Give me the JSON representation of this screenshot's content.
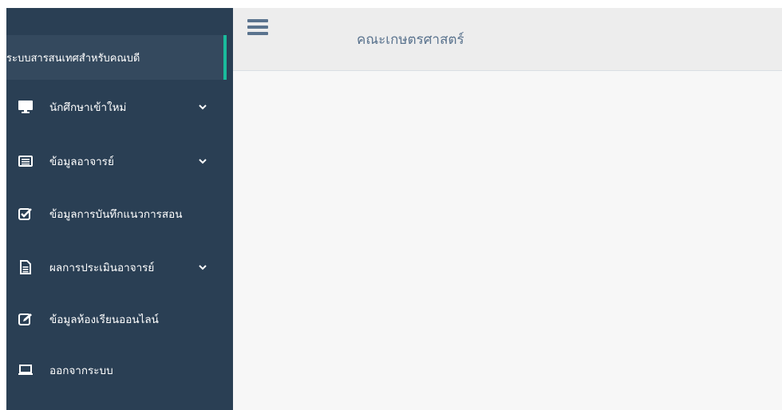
{
  "sidebar": {
    "brand": "ระบบสารสนเทศสำหรับคณบดี",
    "items": [
      {
        "label": "นักศึกษาเข้าใหม่",
        "icon": "monitor-icon",
        "has_submenu": true
      },
      {
        "label": "ข้อมูลอาจารย์",
        "icon": "id-card-icon",
        "has_submenu": true
      },
      {
        "label": "ข้อมูลการบันทึกแนวการสอน",
        "icon": "checkbox-icon",
        "has_submenu": false
      },
      {
        "label": "ผลการประเมินอาจารย์",
        "icon": "document-icon",
        "has_submenu": true
      },
      {
        "label": "ข้อมูลห้องเรียนออนไลน์",
        "icon": "edit-icon",
        "has_submenu": false
      },
      {
        "label": "ออกจากระบบ",
        "icon": "laptop-icon",
        "has_submenu": false
      }
    ]
  },
  "header": {
    "title": "คณะเกษตรศาสตร์",
    "menu_icon": "hamburger-icon"
  },
  "colors": {
    "sidebar_bg": "#2a3f54",
    "brand_bg": "#34495e",
    "accent": "#1abb9c",
    "topbar_bg": "#ededed",
    "content_bg": "#f7f7f7",
    "title_text": "#5a738e"
  }
}
